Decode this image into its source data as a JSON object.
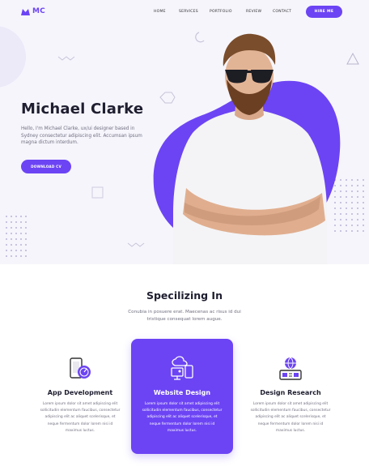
{
  "brand": {
    "logo_text": "MC",
    "accent": "#6c44f4"
  },
  "nav": {
    "items": [
      {
        "label": "HOME"
      },
      {
        "label": "SERVICES"
      },
      {
        "label": "PORTFOLIO"
      },
      {
        "label": "REVIEW"
      },
      {
        "label": "CONTACT"
      }
    ],
    "hire_label": "HIRE ME"
  },
  "hero": {
    "name": "Michael Clarke",
    "description": "Hello, I'm Michael Clarke, ux/ui designer based in Sydney consectetur adipiscing elit. Accumsan ipsum magna dictum interdum.",
    "cv_label": "DOWNLOAD CV"
  },
  "specializing": {
    "title": "Specilizing In",
    "subtitle": "Conubia in posuere erat. Maecenas ac risus id dui tristique consequat lorem augue."
  },
  "services": [
    {
      "icon": "mobile-gauge-icon",
      "title": "App Development",
      "body": "Lorem ipsum dolor sit amet adipiscing elit sollicitudin elementum faucibus, consectetur adipiscing elit ac aliquet scelerisque, et neque fermentum dolor lorem nisi id maximus luctus."
    },
    {
      "icon": "cloud-monitor-icon",
      "title": "Website Design",
      "body": "Lorem ipsum dolor sit amet adipiscing elit sollicitudin elementum faucibus, consectetur adipiscing elit ac aliquet scelerisque, et neque fermentum dolor lorem nisi id maximus luctus."
    },
    {
      "icon": "globe-toolbox-icon",
      "title": "Design Research",
      "body": "Lorem ipsum dolor sit amet adipiscing elit sollicitudin elementum faucibus, consectetur adipiscing elit ac aliquet scelerisque, et neque fermentum dolor lorem nisi id maximus luctus."
    }
  ]
}
